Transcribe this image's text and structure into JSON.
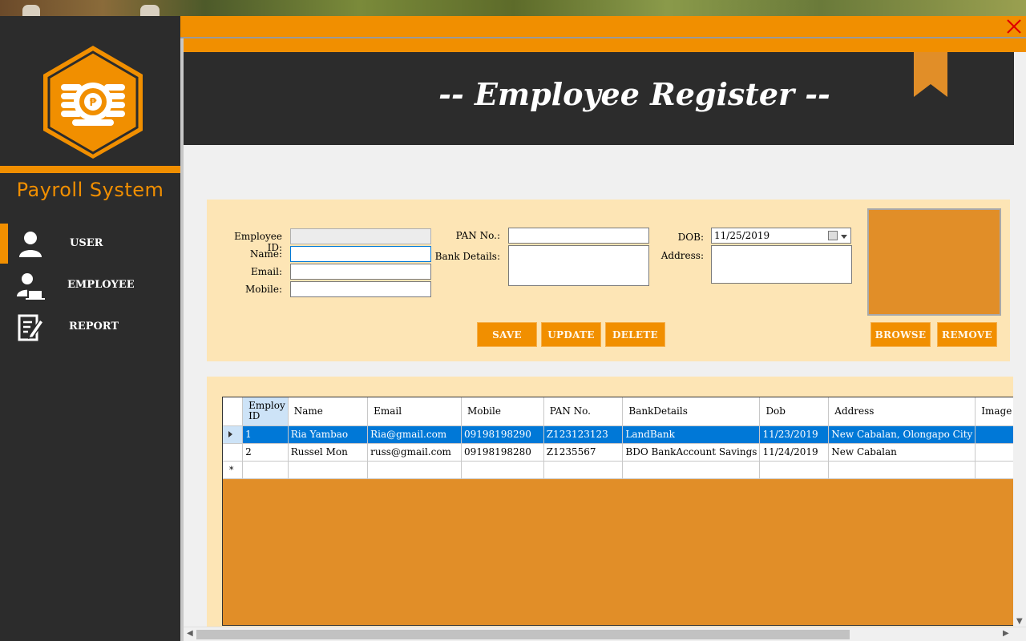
{
  "app": {
    "title": "Payroll System",
    "page_title": "-- Employee Register --",
    "accent_color": "#f18f00",
    "dark_color": "#2c2c2c"
  },
  "sidebar": {
    "items": [
      {
        "label": "USER",
        "icon": "user-icon",
        "active": true
      },
      {
        "label": "EMPLOYEE",
        "icon": "employee-icon",
        "active": false
      },
      {
        "label": "REPORT",
        "icon": "report-icon",
        "active": false
      }
    ]
  },
  "form": {
    "employee_id": {
      "label": "Employee ID:",
      "value": ""
    },
    "name": {
      "label": "Name:",
      "value": ""
    },
    "email": {
      "label": "Email:",
      "value": ""
    },
    "mobile": {
      "label": "Mobile:",
      "value": ""
    },
    "pan": {
      "label": "PAN No.:",
      "value": ""
    },
    "bank": {
      "label": "Bank Details:",
      "value": ""
    },
    "dob": {
      "label": "DOB:",
      "value": "11/25/2019"
    },
    "address": {
      "label": "Address:",
      "value": ""
    }
  },
  "buttons": {
    "save": "SAVE",
    "update": "UPDATE",
    "delete": "DELETE",
    "browse": "BROWSE",
    "remove": "REMOVE"
  },
  "grid": {
    "columns": [
      "Employ ID",
      "Name",
      "Email",
      "Mobile",
      "PAN No.",
      "BankDetails",
      "Dob",
      "Address",
      "Image"
    ],
    "rows": [
      [
        "1",
        "Ria Yambao",
        "Ria@gmail.com",
        "09198198290",
        "Z123123123",
        "LandBank",
        "11/23/2019",
        "New Cabalan, Olongapo City",
        ""
      ],
      [
        "2",
        "Russel Mon",
        "russ@gmail.com",
        "09198198280",
        "Z1235567",
        "BDO BankAccount Savings",
        "11/24/2019",
        "New Cabalan",
        ""
      ]
    ],
    "new_row_marker": "*",
    "selected_row": 0
  }
}
